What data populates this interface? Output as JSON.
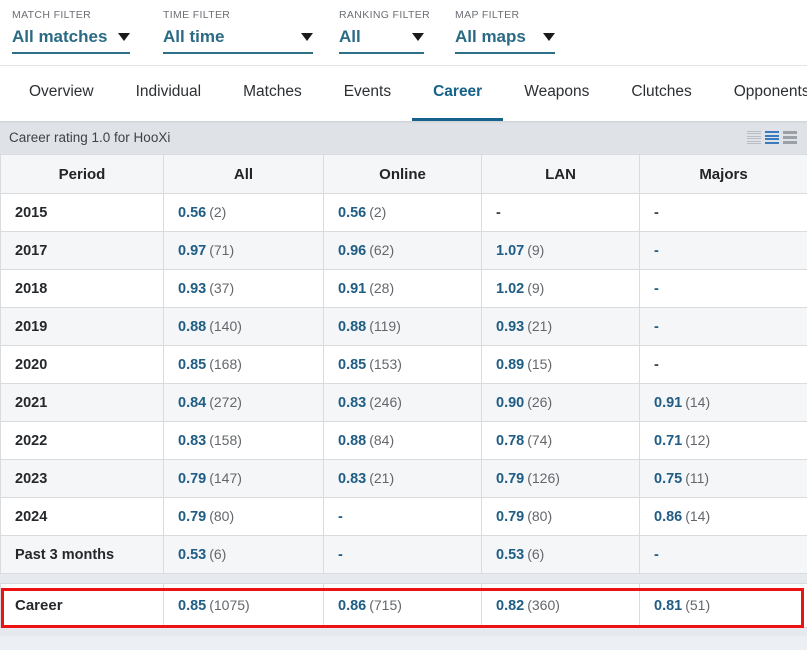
{
  "filters": [
    {
      "key": "match",
      "label": "MATCH FILTER",
      "value": "All matches",
      "icon": "chevron-down-icon"
    },
    {
      "key": "time",
      "label": "TIME FILTER",
      "value": "All time",
      "icon": "chevron-down-icon"
    },
    {
      "key": "ranking",
      "label": "RANKING FILTER",
      "value": "All",
      "icon": "chevron-down-icon"
    },
    {
      "key": "map",
      "label": "MAP FILTER",
      "value": "All maps",
      "icon": "chevron-down-icon"
    }
  ],
  "tabs": [
    {
      "label": "Overview",
      "active": false
    },
    {
      "label": "Individual",
      "active": false
    },
    {
      "label": "Matches",
      "active": false
    },
    {
      "label": "Events",
      "active": false
    },
    {
      "label": "Career",
      "active": true
    },
    {
      "label": "Weapons",
      "active": false
    },
    {
      "label": "Clutches",
      "active": false
    },
    {
      "label": "Opponents",
      "active": false
    }
  ],
  "panel": {
    "title": "Career rating 1.0 for HooXi",
    "view_toggles": [
      {
        "name": "view-compact-icon",
        "active": false
      },
      {
        "name": "view-default-icon",
        "active": true
      },
      {
        "name": "view-expanded-icon",
        "active": false
      }
    ]
  },
  "table": {
    "columns": [
      "Period",
      "All",
      "Online",
      "LAN",
      "Majors"
    ],
    "rows": [
      {
        "period": "2015",
        "all": {
          "rating": "0.56",
          "count": "(2)"
        },
        "online": {
          "rating": "0.56",
          "count": "(2)"
        },
        "lan": {
          "dash": "-"
        },
        "majors": {
          "dash": "-"
        }
      },
      {
        "period": "2017",
        "all": {
          "rating": "0.97",
          "count": "(71)"
        },
        "online": {
          "rating": "0.96",
          "count": "(62)"
        },
        "lan": {
          "rating": "1.07",
          "count": "(9)"
        },
        "majors": {
          "dash": "-",
          "blue": true
        }
      },
      {
        "period": "2018",
        "all": {
          "rating": "0.93",
          "count": "(37)"
        },
        "online": {
          "rating": "0.91",
          "count": "(28)"
        },
        "lan": {
          "rating": "1.02",
          "count": "(9)"
        },
        "majors": {
          "dash": "-",
          "blue": true
        }
      },
      {
        "period": "2019",
        "all": {
          "rating": "0.88",
          "count": "(140)"
        },
        "online": {
          "rating": "0.88",
          "count": "(119)"
        },
        "lan": {
          "rating": "0.93",
          "count": "(21)"
        },
        "majors": {
          "dash": "-",
          "blue": true
        }
      },
      {
        "period": "2020",
        "all": {
          "rating": "0.85",
          "count": "(168)"
        },
        "online": {
          "rating": "0.85",
          "count": "(153)"
        },
        "lan": {
          "rating": "0.89",
          "count": "(15)"
        },
        "majors": {
          "dash": "-"
        }
      },
      {
        "period": "2021",
        "all": {
          "rating": "0.84",
          "count": "(272)"
        },
        "online": {
          "rating": "0.83",
          "count": "(246)"
        },
        "lan": {
          "rating": "0.90",
          "count": "(26)"
        },
        "majors": {
          "rating": "0.91",
          "count": "(14)"
        }
      },
      {
        "period": "2022",
        "all": {
          "rating": "0.83",
          "count": "(158)"
        },
        "online": {
          "rating": "0.88",
          "count": "(84)"
        },
        "lan": {
          "rating": "0.78",
          "count": "(74)"
        },
        "majors": {
          "rating": "0.71",
          "count": "(12)"
        },
        "highlighted": true
      },
      {
        "period": "2023",
        "all": {
          "rating": "0.79",
          "count": "(147)"
        },
        "online": {
          "rating": "0.83",
          "count": "(21)"
        },
        "lan": {
          "rating": "0.79",
          "count": "(126)"
        },
        "majors": {
          "rating": "0.75",
          "count": "(11)"
        }
      },
      {
        "period": "2024",
        "all": {
          "rating": "0.79",
          "count": "(80)"
        },
        "online": {
          "dash": "-",
          "blue": true
        },
        "lan": {
          "rating": "0.79",
          "count": "(80)"
        },
        "majors": {
          "rating": "0.86",
          "count": "(14)"
        }
      },
      {
        "period": "Past 3 months",
        "all": {
          "rating": "0.53",
          "count": "(6)"
        },
        "online": {
          "dash": "-",
          "blue": true
        },
        "lan": {
          "rating": "0.53",
          "count": "(6)"
        },
        "majors": {
          "dash": "-",
          "blue": true
        }
      }
    ],
    "footer": {
      "period": "Career",
      "all": {
        "rating": "0.85",
        "count": "(1075)"
      },
      "online": {
        "rating": "0.86",
        "count": "(715)"
      },
      "lan": {
        "rating": "0.82",
        "count": "(360)"
      },
      "majors": {
        "rating": "0.81",
        "count": "(51)"
      }
    }
  },
  "colors": {
    "accent": "#205d85",
    "tab_active": "#15628a",
    "highlight": "#ee1111",
    "filter_underline": "#2d6f85"
  }
}
